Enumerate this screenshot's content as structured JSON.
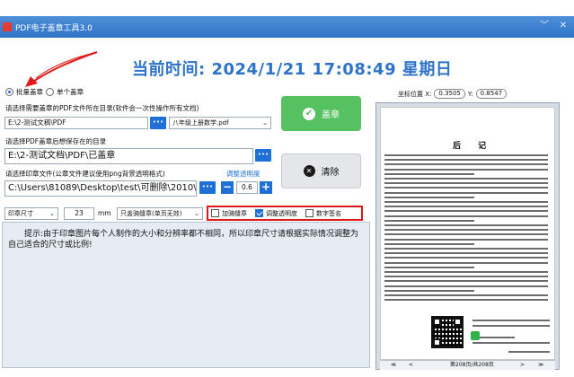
{
  "window": {
    "title": "PDF电子盖章工具3.0",
    "minimize_glyph": "﹀",
    "close_glyph": "✕"
  },
  "header": {
    "time_label": "当前时间: 2024/1/21 17:08:49 星期日"
  },
  "mode": {
    "batch_label": "批量盖章",
    "single_label": "单个盖章",
    "selected": "batch"
  },
  "source": {
    "label": "请选择需要盖章的PDF文件所在目录(软件会一次性操作所有文档)",
    "path": "E:\\2-测试文稿\\PDF",
    "browse_label": "•••",
    "file_select": "八年级上册数学.pdf"
  },
  "output": {
    "label": "请选择PDF盖章后想保存在的目录",
    "path": "E:\\2-测试文档\\PDF\\已盖章",
    "browse_label": "•••"
  },
  "stamp": {
    "label": "请选择印章文件(公章文件建议使用png背景透明格式)",
    "adjust_label": "调整透明度",
    "path": "C:\\Users\\81089\\Desktop\\test\\可删除\\2010\\",
    "browse_label": "•••",
    "opacity": "0.6",
    "minus_label": "−",
    "plus_label": "+"
  },
  "buttons": {
    "seal": "盖章",
    "clear": "清除"
  },
  "size": {
    "select_label": "印章尺寸",
    "value": "23",
    "unit": "mm",
    "riding_select": "只盖骑缝章(单页无效)"
  },
  "options": {
    "add_riding": {
      "label": "加骑缝章",
      "checked": false
    },
    "adjust_opacity": {
      "label": "调整透明度",
      "checked": true
    },
    "digital_sign": {
      "label": "数字签名",
      "checked": false
    }
  },
  "info": {
    "text": "提示:由于印章图片每个人制作的大小和分辨率都不相同，所以印章尺寸请根据实际情况调整为自己适合的尺寸或比例!"
  },
  "coords": {
    "label": "坐标位置 X:",
    "x": "0.3505",
    "y_label": "Y:",
    "y": "0.8547"
  },
  "preview": {
    "page_title": "后 记",
    "page_info": "第208页/共208页",
    "pager_first": "≪",
    "pager_prev": "<",
    "pager_next": ">",
    "pager_last": "≫"
  },
  "colors": {
    "accent": "#2e73c8",
    "seal_green": "#55c160",
    "highlight_red": "#e01818"
  }
}
